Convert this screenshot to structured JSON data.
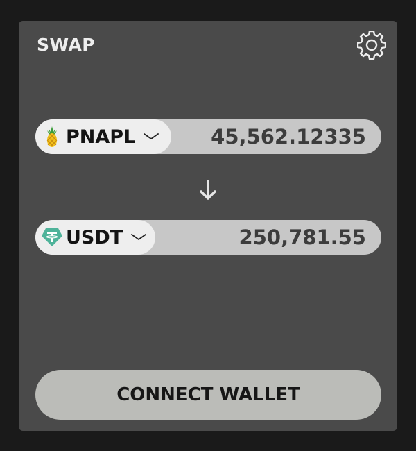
{
  "swap": {
    "title": "SWAP",
    "settings_icon": "gear-icon"
  },
  "from": {
    "symbol": "PNAPL",
    "icon": "pineapple-icon",
    "amount": "45,562.12335"
  },
  "direction_icon": "arrow-down-icon",
  "to": {
    "symbol": "USDT",
    "icon": "tether-icon",
    "amount": "250,781.55"
  },
  "connect_button": {
    "label": "CONNECT WALLET"
  },
  "colors": {
    "page_bg": "#1a1a1a",
    "card_bg": "#4a4a4a",
    "field_bg": "#c7c7c7",
    "token_pill_bg": "#eeeeee",
    "button_bg": "#bbbcb8",
    "tether_green": "#4fb39a"
  }
}
